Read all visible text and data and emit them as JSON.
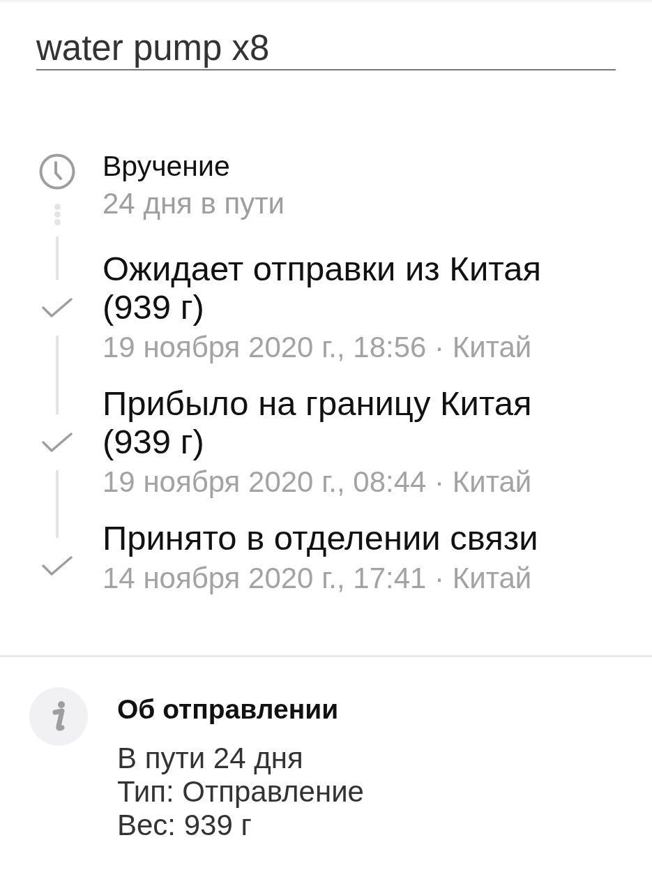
{
  "title_field": {
    "value": "water pump x8"
  },
  "timeline": [
    {
      "kind": "pending",
      "title": "Вручение",
      "subtitle": "24 дня в пути"
    },
    {
      "kind": "done",
      "title": "Ожидает отправки из Китая (939 г)",
      "subtitle": "19 ноября 2020 г., 18:56 · Китай"
    },
    {
      "kind": "done",
      "title": "Прибыло на границу Китая (939 г)",
      "subtitle": "19 ноября 2020 г., 08:44 · Китай"
    },
    {
      "kind": "done",
      "title": "Принято в отделении связи",
      "subtitle": "14 ноября 2020 г., 17:41 · Китай"
    }
  ],
  "info": {
    "title": "Об отправлении",
    "lines": [
      "В пути 24 дня",
      "Тип: Отправление",
      "Вес: 939 г"
    ]
  }
}
